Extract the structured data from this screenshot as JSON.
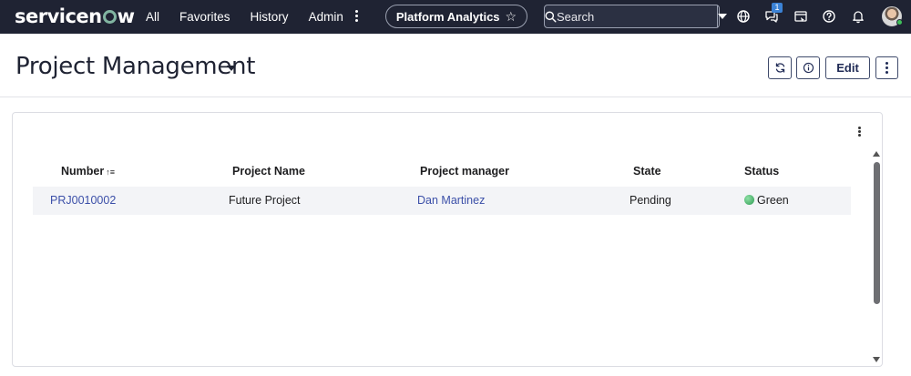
{
  "nav": {
    "logo": "servicenow",
    "links": [
      "All",
      "Favorites",
      "History",
      "Admin"
    ],
    "workspace_pill": "Platform Analytics",
    "search": {
      "placeholder": "Search"
    },
    "chat_badge": "1",
    "icons": [
      "globe-icon",
      "chat-icon",
      "scratchpad-icon",
      "help-icon",
      "bell-icon",
      "user-avatar"
    ]
  },
  "page": {
    "title": "Project Management",
    "edit_label": "Edit"
  },
  "table": {
    "columns": [
      "Number",
      "Project Name",
      "Project manager",
      "State",
      "Status"
    ],
    "rows": [
      {
        "number": "PRJ0010002",
        "name": "Future Project",
        "manager": "Dan Martinez",
        "state": "Pending",
        "status": "Green"
      }
    ]
  },
  "colors": {
    "nav_bg": "#1f2333",
    "link": "#3b4fa8",
    "status_green": "#2d9b52",
    "row_bg": "#f3f4f7"
  }
}
